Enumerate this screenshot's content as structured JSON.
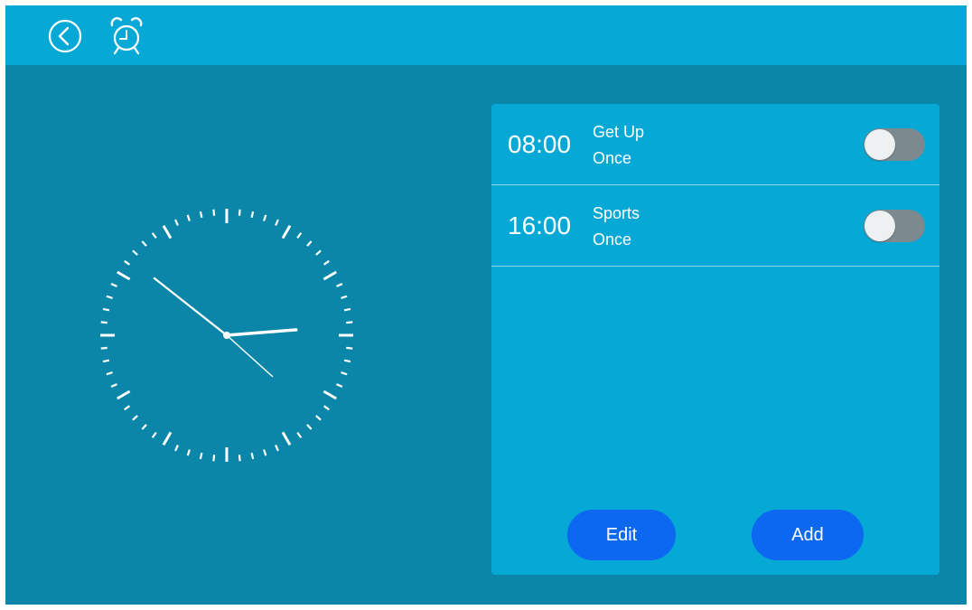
{
  "header": {
    "back_icon": "chevron-left-circle-icon",
    "app_icon": "alarm-clock-icon"
  },
  "analog_clock": {
    "hour": 2,
    "minute": 51,
    "second": 22
  },
  "alarms": [
    {
      "time": "08:00",
      "label": "Get Up",
      "repeat": "Once",
      "enabled": false
    },
    {
      "time": "16:00",
      "label": "Sports",
      "repeat": "Once",
      "enabled": false
    }
  ],
  "actions": {
    "edit_label": "Edit",
    "add_label": "Add"
  },
  "colors": {
    "background": "#0b86a8",
    "header": "#06a8d6",
    "panel": "#06a8d6",
    "button": "#0c68f0",
    "toggle_off_track": "#7c8a8f"
  }
}
